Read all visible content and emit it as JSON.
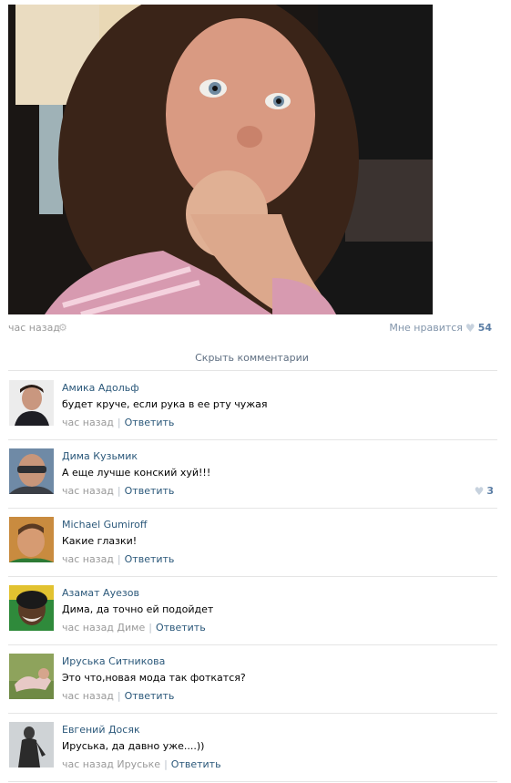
{
  "post": {
    "time": "час назад",
    "like_label": "Мне нравится",
    "like_count": "54",
    "hide_comments": "Скрыть комментарии"
  },
  "comments": [
    {
      "author": "Амика Адольф",
      "text": "будет круче, если рука в ее рту чужая",
      "time": "час назад",
      "reply": "Ответить"
    },
    {
      "author": "Дима Кузьмик",
      "text": "А еще лучше конский хуй!!!",
      "time": "час назад",
      "reply": "Ответить",
      "likes": "3"
    },
    {
      "author": "Michael Gumiroff",
      "text": "Какие глазки!",
      "time": "час назад",
      "reply": "Ответить"
    },
    {
      "author": "Азамат Ауезов",
      "text": "Дима, да точно ей подойдет",
      "time": "час назад Диме",
      "reply": "Ответить"
    },
    {
      "author": "Ируська Ситникова",
      "text": "Это что,новая мода так фоткатся?",
      "time": "час назад",
      "reply": "Ответить"
    },
    {
      "author": "Евгений Досяк",
      "text": "Ируська, да давно уже....))",
      "time": "час назад Ируське",
      "reply": "Ответить"
    }
  ]
}
